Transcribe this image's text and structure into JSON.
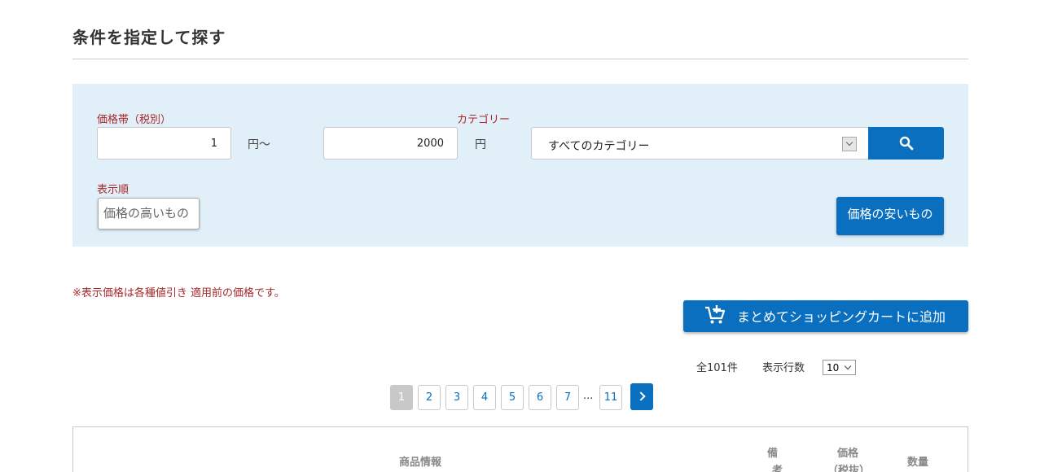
{
  "section": {
    "heading": "条件を指定して探す"
  },
  "filters": {
    "price_label": "価格帯（税別）",
    "min_price": "1",
    "min_unit": "円〜",
    "max_price": "2000",
    "max_unit": "円",
    "category_label": "カテゴリー",
    "category_selected": "すべてのカテゴリー",
    "sort_label": "表示順",
    "sort_option_high": "価格の高いもの",
    "sort_option_low": "価格の安いもの"
  },
  "notice": "※表示価格は各種値引き 適用前の価格です。",
  "cart_button": {
    "label": "まとめてショッピングカートに追加",
    "icon": "add-to-cart-icon"
  },
  "results": {
    "total": "全101件",
    "rows_label": "表示行数",
    "rows_value": "10"
  },
  "pagination": {
    "pages": [
      "1",
      "2",
      "3",
      "4",
      "5",
      "6",
      "7"
    ],
    "ellipsis": "...",
    "last": "11",
    "current": "1"
  },
  "table": {
    "col_product": "商品情報",
    "col_notes_1": "備",
    "col_notes_2": "考",
    "col_price_1": "価格",
    "col_price_2": "（税抜）",
    "col_qty": "数量"
  },
  "colors": {
    "accent": "#0a6fbe",
    "panel": "#e1eff8",
    "label_red": "#a8282a"
  }
}
